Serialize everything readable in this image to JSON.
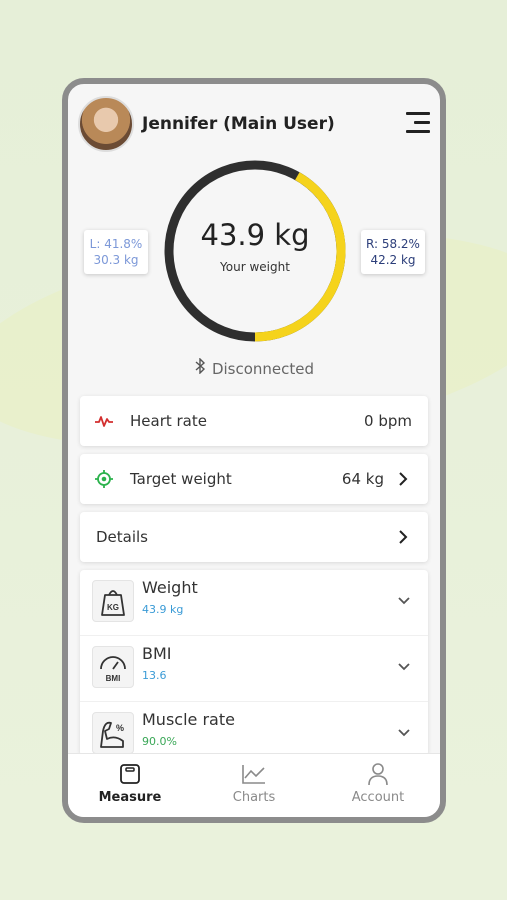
{
  "header": {
    "user_name": "Jennifer (Main User)"
  },
  "gauge": {
    "weight": "43.9 kg",
    "weight_label": "Your weight",
    "left_fraction": 0.418,
    "arc_color": "#f5d31c",
    "track_color": "#2f2f2f"
  },
  "left_card": {
    "percent": "L: 41.8%",
    "kg": "30.3 kg"
  },
  "right_card": {
    "percent": "R: 58.2%",
    "kg": "42.2 kg"
  },
  "bluetooth": {
    "status": "Disconnected"
  },
  "heart_rate": {
    "label": "Heart rate",
    "value": "0 bpm",
    "color": "#d32f2f"
  },
  "target_weight": {
    "label": "Target weight",
    "value": "64 kg",
    "color": "#2bb24c"
  },
  "details": {
    "label": "Details"
  },
  "metrics": [
    {
      "name": "Weight",
      "value": "43.9 kg",
      "color": "#3b9bd6",
      "icon": "weight-scale-icon"
    },
    {
      "name": "BMI",
      "value": "13.6",
      "color": "#3b9bd6",
      "icon": "bmi-gauge-icon"
    },
    {
      "name": "Muscle rate",
      "value": "90.0%",
      "color": "#3aa757",
      "icon": "muscle-icon"
    }
  ],
  "tabs": [
    {
      "label": "Measure",
      "active": true,
      "icon": "scale-icon"
    },
    {
      "label": "Charts",
      "active": false,
      "icon": "chart-icon"
    },
    {
      "label": "Account",
      "active": false,
      "icon": "person-icon"
    }
  ]
}
